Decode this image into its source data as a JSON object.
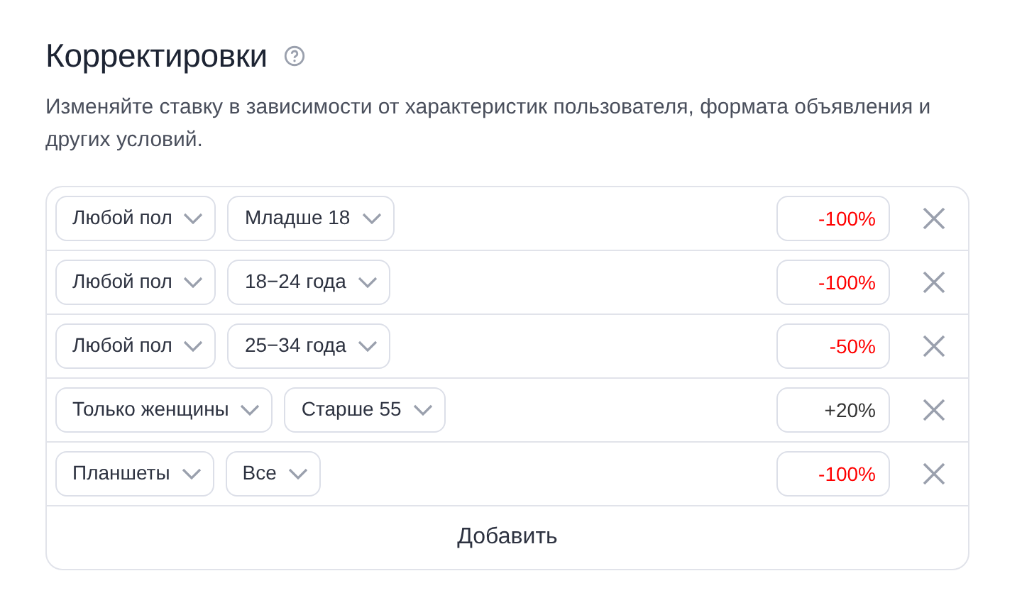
{
  "title": "Корректировки",
  "description": "Изменяйте ставку в зависимости от характеристик пользователя, формата объявления и других условий.",
  "adjustments": [
    {
      "selects": [
        "Любой пол",
        "Младше 18"
      ],
      "value": "-100%",
      "color": "#ff0000"
    },
    {
      "selects": [
        "Любой пол",
        "18−24 года"
      ],
      "value": "-100%",
      "color": "#ff0000"
    },
    {
      "selects": [
        "Любой пол",
        "25−34 года"
      ],
      "value": "-50%",
      "color": "#ff0000"
    },
    {
      "selects": [
        "Только женщины",
        "Старше 55"
      ],
      "value": "+20%",
      "color": "#333333"
    },
    {
      "selects": [
        "Планшеты",
        "Все"
      ],
      "value": "-100%",
      "color": "#ff0000"
    }
  ],
  "add_button": "Добавить"
}
